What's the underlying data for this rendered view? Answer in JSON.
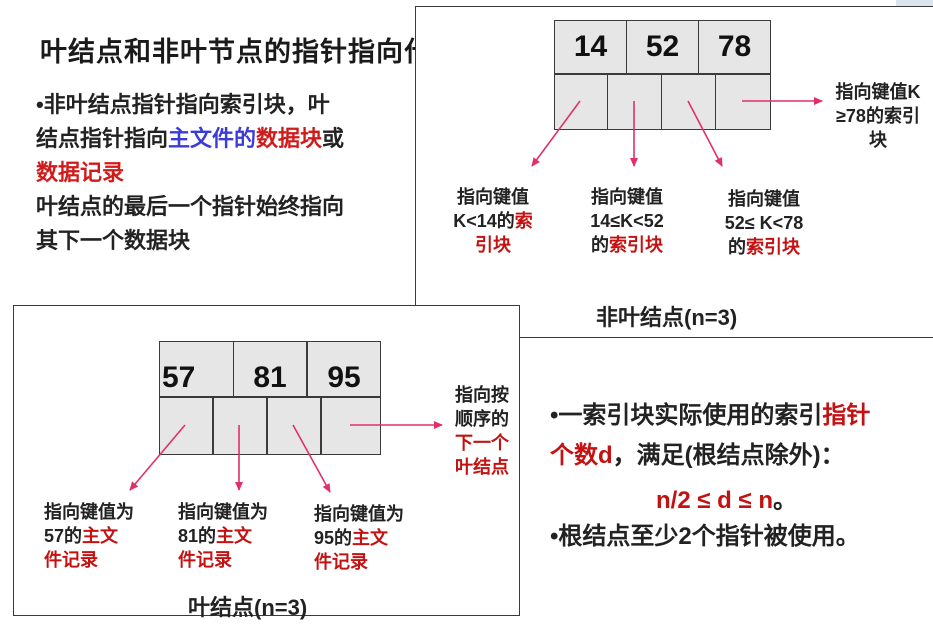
{
  "title": "叶结点和非叶节点的指针指向什么?",
  "bullets": {
    "l1": "•非叶结点指针指向索引块，叶",
    "l2_a": "结点指针指向",
    "l2_b": "主文件的",
    "l2_c": "数据块",
    "l2_d": "或",
    "l3": "数据记录",
    "l4": "叶结点的最后一个指针始终指向",
    "l5": "其下一个数据块"
  },
  "nonleaf": {
    "keys": [
      "14",
      "52",
      "78"
    ],
    "p1": {
      "l1": "指向键值",
      "l2a": "K<14的",
      "l2b": "索",
      "l3": "引块"
    },
    "p2": {
      "l1": "指向键值",
      "l2": "14≤K<52",
      "l3a": "的",
      "l3b": "索引块"
    },
    "p3": {
      "l1": "指向键值",
      "l2": "52≤ K<78",
      "l3a": "的",
      "l3b": "索引块"
    },
    "p4": {
      "l1": "指向键值K",
      "l2": "≥78的索引",
      "l3": "块"
    },
    "caption": "非叶结点(n=3)"
  },
  "leaf": {
    "keys": [
      "57",
      "81",
      "95"
    ],
    "p1": {
      "l1": "指向键值为",
      "l2a": "57的",
      "l2b": "主文",
      "l3": "件记录"
    },
    "p2": {
      "l1": "指向键值为",
      "l2a": "81的",
      "l2b": "主文",
      "l3": "件记录"
    },
    "p3": {
      "l1": "指向键值为",
      "l2a": "95的",
      "l2b": "主文",
      "l3": "件记录"
    },
    "next": {
      "l1": "指向按",
      "l2": "顺序的",
      "l3": "下一个",
      "l4": "叶结点"
    },
    "caption": "叶结点(n=3)"
  },
  "side": {
    "b1a": "•一索引块实际使用的索引",
    "b1b": "指针",
    "b2a": "个数d",
    "b2b": "，满足(根结点除外)：",
    "formula": "n/2 ≤ d ≤ n",
    "formula_end": "。",
    "b3": "•根结点至少2个指针被使用。"
  },
  "colors": {
    "arrow": "#e0306a",
    "red_text": "#c41212",
    "blue_text": "#3b3bd6",
    "cell_fill": "#e6e6e6"
  }
}
